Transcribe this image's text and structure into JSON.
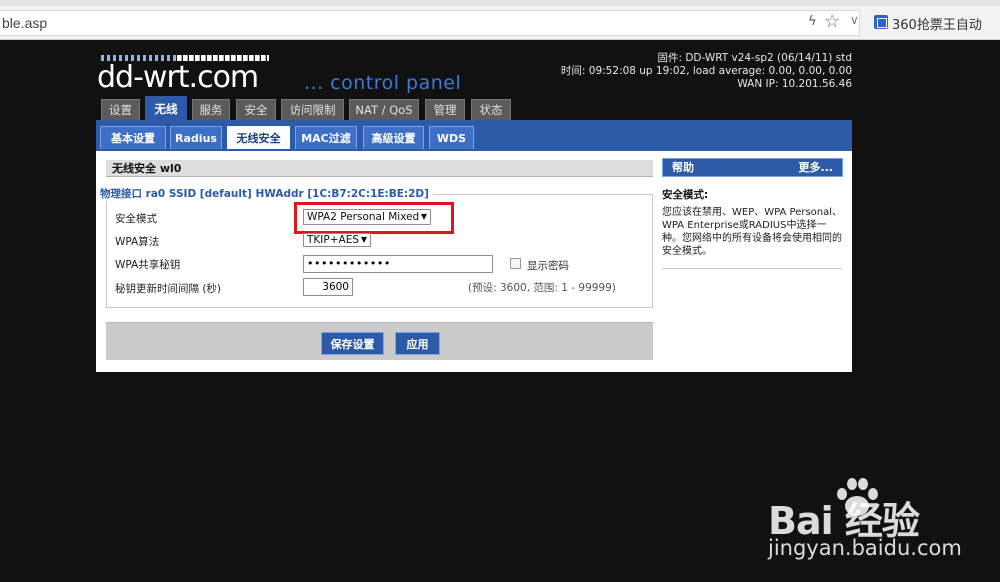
{
  "browser": {
    "url": "ble.asp",
    "extension_label": "360抢票王自动"
  },
  "header": {
    "logo_text": "dd-wrt.com",
    "tagline": "... control panel",
    "firmware": "固件: DD-WRT v24-sp2 (06/14/11) std",
    "time": "时间: 09:52:08 up 19:02, load average: 0.00, 0.00, 0.00",
    "wan_ip": "WAN IP: 10.201.56.46"
  },
  "tabs": [
    "设置",
    "无线",
    "服务",
    "安全",
    "访问限制",
    "NAT / QoS",
    "管理",
    "状态"
  ],
  "subtabs": [
    "基本设置",
    "Radius",
    "无线安全",
    "MAC过滤",
    "高级设置",
    "WDS"
  ],
  "section": {
    "title": "无线安全 wl0",
    "legend": "物理接口 ra0 SSID [default] HWAddr [1C:B7:2C:1E:BE:2D]"
  },
  "form": {
    "security_mode_label": "安全模式",
    "security_mode_value": "WPA2 Personal Mixed",
    "wpa_algo_label": "WPA算法",
    "wpa_algo_value": "TKIP+AES",
    "wpa_key_label": "WPA共享秘钥",
    "wpa_key_value": "••••••••••••",
    "show_password_label": "显示密码",
    "rekey_label": "秘钥更新时间间隔 (秒)",
    "rekey_value": "3600",
    "rekey_hint": "(预设: 3600, 范围: 1 - 99999)"
  },
  "buttons": {
    "save": "保存设置",
    "apply": "应用"
  },
  "help": {
    "title": "帮助",
    "more": "更多...",
    "subtitle": "安全模式:",
    "body": "您应该在禁用、WEP、WPA Personal、WPA Enterprise或RADIUS中选择一种。您网络中的所有设备将会使用相同的安全模式。"
  },
  "watermark": {
    "logo": "Bai  经验",
    "url": "jingyan.baidu.com"
  },
  "colors": {
    "accent": "#2c5aa9",
    "highlight": "#e0141b"
  }
}
